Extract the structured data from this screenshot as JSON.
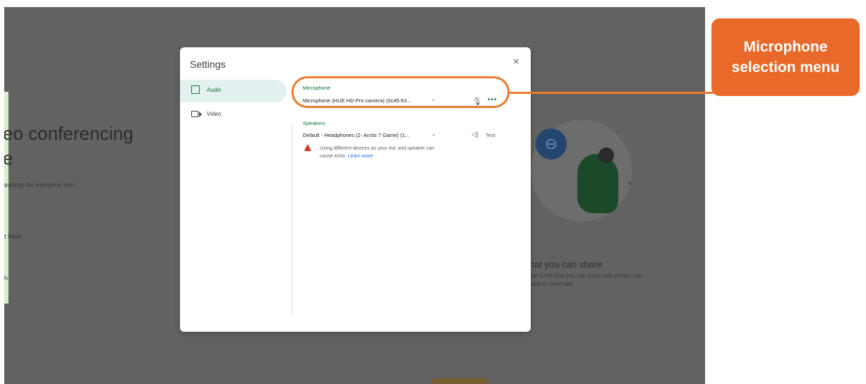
{
  "background": {
    "heading_line1": "eo conferencing",
    "heading_line2": "e",
    "small1": "eetings for everyone with",
    "small2": "t Meet",
    "small3": "h",
    "right_heading": "hat you can share",
    "right_sub1": "Get a link that you can share with people you",
    "right_sub2": "want to meet with",
    "dot": "."
  },
  "settings": {
    "title": "Settings",
    "close": "×",
    "nav": [
      {
        "label": "Audio",
        "icon": "speaker-box-icon"
      },
      {
        "label": "Video",
        "icon": "camera-icon"
      }
    ],
    "microphone": {
      "section_label": "Microphone",
      "value": "Microphone (HUE HD Pro camera) (0c45:63...",
      "chevron": "⌄"
    },
    "speakers": {
      "section_label": "Speakers",
      "value": "Default - Headphones (2- Arctis 7 Game) (1...",
      "chevron": "⌄",
      "test_label": "Test"
    },
    "warning": {
      "text": "Using different devices as your mic and speaker can cause echo.",
      "link": "Learn more"
    }
  },
  "callout": {
    "text_line1": "Microphone",
    "text_line2": "selection menu"
  },
  "colors": {
    "accent_green": "#137333",
    "callout_orange": "#e8692a",
    "highlight_orange": "#f07c2a"
  }
}
